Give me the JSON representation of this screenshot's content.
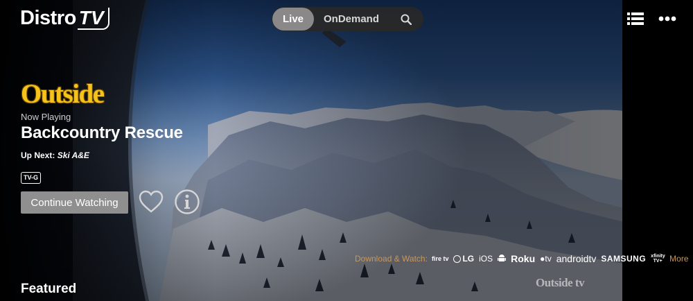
{
  "brand": {
    "name_part1": "Distro",
    "name_part2": "TV"
  },
  "nav": {
    "live_label": "Live",
    "ondemand_label": "OnDemand",
    "search_icon": "search-icon"
  },
  "header_icons": {
    "menu": "list-menu-icon",
    "more": "more-dots-icon"
  },
  "hero": {
    "channel_logo": "Outside",
    "now_playing_label": "Now Playing",
    "title": "Backcountry Rescue",
    "up_next_label": "Up Next:",
    "up_next_title": "Ski A&E",
    "rating": "TV-G",
    "cta_label": "Continue Watching",
    "watermark": "Outside tv"
  },
  "download": {
    "label": "Download & Watch:",
    "platforms": [
      "fire tv",
      "LG",
      "iOS",
      "Android",
      "Roku",
      "tv",
      "androidtv",
      "SAMSUNG",
      "xfinity TV+"
    ],
    "more_label": "More"
  },
  "sections": {
    "featured": "Featured"
  },
  "colors": {
    "accent_gold": "#f6c31a",
    "download_label": "#c9975a",
    "active_tab": "#8a8888",
    "cta_bg": "#8f8f8f"
  }
}
